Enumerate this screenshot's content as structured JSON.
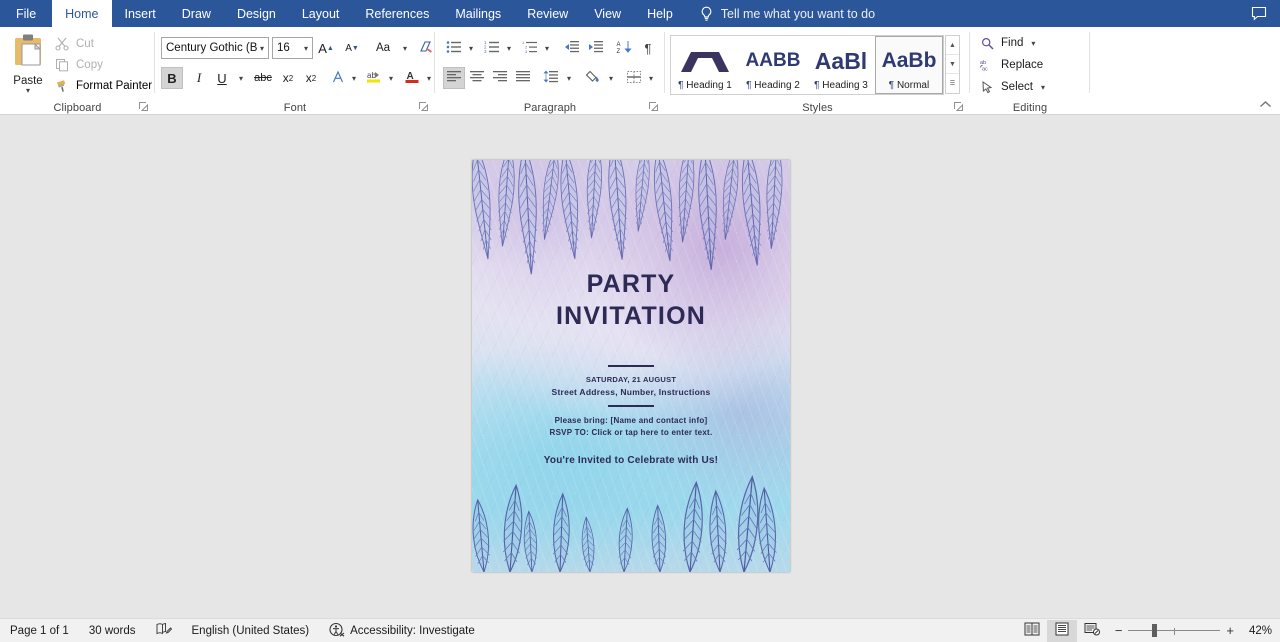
{
  "app": {
    "tabs": [
      {
        "label": "File",
        "active": false
      },
      {
        "label": "Home",
        "active": true
      },
      {
        "label": "Insert",
        "active": false
      },
      {
        "label": "Draw",
        "active": false
      },
      {
        "label": "Design",
        "active": false
      },
      {
        "label": "Layout",
        "active": false
      },
      {
        "label": "References",
        "active": false
      },
      {
        "label": "Mailings",
        "active": false
      },
      {
        "label": "Review",
        "active": false
      },
      {
        "label": "View",
        "active": false
      },
      {
        "label": "Help",
        "active": false
      }
    ],
    "tellme_placeholder": "Tell me what you want to do",
    "comments_icon": "comment-icon",
    "ribbon_collapse_icon": "chevron-up-icon",
    "accent_color": "#2b579a"
  },
  "ribbon": {
    "clipboard": {
      "label": "Clipboard",
      "paste": "Paste",
      "cut": "Cut",
      "copy": "Copy",
      "format_painter": "Format Painter",
      "launcher_icon": "dialog-launcher-icon"
    },
    "font": {
      "label": "Font",
      "font_name": "Century Gothic (B",
      "font_size": "16",
      "grow_font": "A",
      "shrink_font": "A",
      "change_case": "Aa",
      "clear_formatting_icon": "clear-formatting-icon",
      "bold": "B",
      "bold_active": true,
      "italic": "I",
      "underline": "U",
      "strikethrough": "abc",
      "subscript": "x",
      "superscript": "x",
      "text_effects_icon": "text-effects-icon",
      "highlight_icon": "text-highlight-icon",
      "font_color_icon": "font-color-icon",
      "launcher_icon": "dialog-launcher-icon"
    },
    "paragraph": {
      "label": "Paragraph",
      "bullets_icon": "bullet-list-icon",
      "numbering_icon": "numbered-list-icon",
      "multilevel_icon": "multilevel-list-icon",
      "decrease_indent_icon": "decrease-indent-icon",
      "increase_indent_icon": "increase-indent-icon",
      "sort_icon": "sort-icon",
      "show_marks_icon": "paragraph-mark-icon",
      "align_left_icon": "align-left-icon",
      "align_left_active": true,
      "align_center_icon": "align-center-icon",
      "align_right_icon": "align-right-icon",
      "justify_icon": "justify-icon",
      "line_spacing_icon": "line-spacing-icon",
      "shading_icon": "shading-icon",
      "borders_icon": "borders-icon",
      "launcher_icon": "dialog-launcher-icon"
    },
    "styles": {
      "label": "Styles",
      "items": [
        {
          "preview": "",
          "name": "Heading 1",
          "selected": false,
          "graphic": true
        },
        {
          "preview": "AABB",
          "name": "Heading 2",
          "selected": false,
          "graphic": false
        },
        {
          "preview": "AaBl",
          "name": "Heading 3",
          "selected": false,
          "graphic": false
        },
        {
          "preview": "AaBb",
          "name": "Normal",
          "selected": true,
          "graphic": false
        }
      ],
      "scroll_up_icon": "scroll-up-icon",
      "scroll_down_icon": "scroll-down-icon",
      "more_styles_icon": "more-styles-icon",
      "launcher_icon": "dialog-launcher-icon"
    },
    "editing": {
      "label": "Editing",
      "find": "Find",
      "find_icon": "search-icon",
      "replace": "Replace",
      "replace_icon": "replace-icon",
      "select": "Select",
      "select_icon": "cursor-select-icon"
    }
  },
  "document": {
    "title_line1": "PARTY",
    "title_line2": "INVITATION",
    "date": "SATURDAY, 21 AUGUST",
    "address": "Street Address, Number, Instructions",
    "bring": "Please bring: [Name and contact info]",
    "rsvp": "RSVP TO: Click or tap here to enter text.",
    "cta": "You're Invited to Celebrate with Us!",
    "text_color": "#2d2a55"
  },
  "statusbar": {
    "page": "Page 1 of 1",
    "words": "30 words",
    "proofing_icon": "proofing-icon",
    "language": "English (United States)",
    "accessibility_icon": "accessibility-icon",
    "accessibility": "Accessibility: Investigate",
    "view_read_icon": "read-mode-icon",
    "view_print_icon": "print-layout-icon",
    "view_web_icon": "web-layout-icon",
    "zoom_out": "−",
    "zoom_in": "+",
    "zoom_level": "42%"
  }
}
